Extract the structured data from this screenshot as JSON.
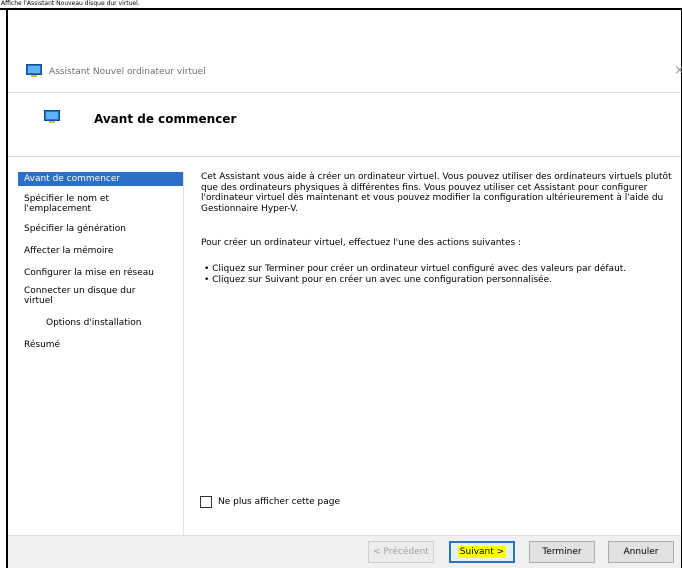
{
  "tooltip": "Affiche l'Assistant Nouveau disque dur virtuel.",
  "window": {
    "title": "Assistant Nouvel ordinateur virtuel",
    "close_glyph": "×"
  },
  "page": {
    "heading": "Avant de commencer"
  },
  "sidebar": {
    "items": [
      {
        "label": "Avant de commencer",
        "selected": true
      },
      {
        "label": "Spécifier le nom et l'emplacement"
      },
      {
        "label": "Spécifier la génération"
      },
      {
        "label": "Affecter la mémoire"
      },
      {
        "label": "Configurer la mise en réseau"
      },
      {
        "label": "Connecter un disque dur virtuel"
      },
      {
        "label": "Options d'installation"
      },
      {
        "label": "Résumé"
      }
    ]
  },
  "content": {
    "intro": "Cet Assistant vous aide à créer un ordinateur virtuel. Vous pouvez utiliser des ordinateurs virtuels plutôt que des ordinateurs physiques à différentes fins. Vous pouvez utiliser cet Assistant pour configurer l'ordinateur virtuel dès maintenant et vous pouvez modifier la configuration ultérieurement à l'aide du Gestionnaire Hyper-V.",
    "prompt": "Pour créer un ordinateur virtuel, effectuez l'une des actions suivantes :",
    "bullets": [
      "• Cliquez sur Terminer pour créer un ordinateur virtuel configuré avec des valeurs par défaut.",
      "• Cliquez sur Suivant pour en créer un avec une configuration personnalisée."
    ]
  },
  "checkbox": {
    "label": "Ne plus afficher cette page",
    "checked": false
  },
  "buttons": {
    "previous": "< Précédent",
    "next": "Suivant >",
    "finish": "Terminer",
    "cancel": "Annuler"
  },
  "colors": {
    "selection": "#2c6fc9",
    "highlight": "#ffff00",
    "icon_blue": "#1e73c8"
  }
}
